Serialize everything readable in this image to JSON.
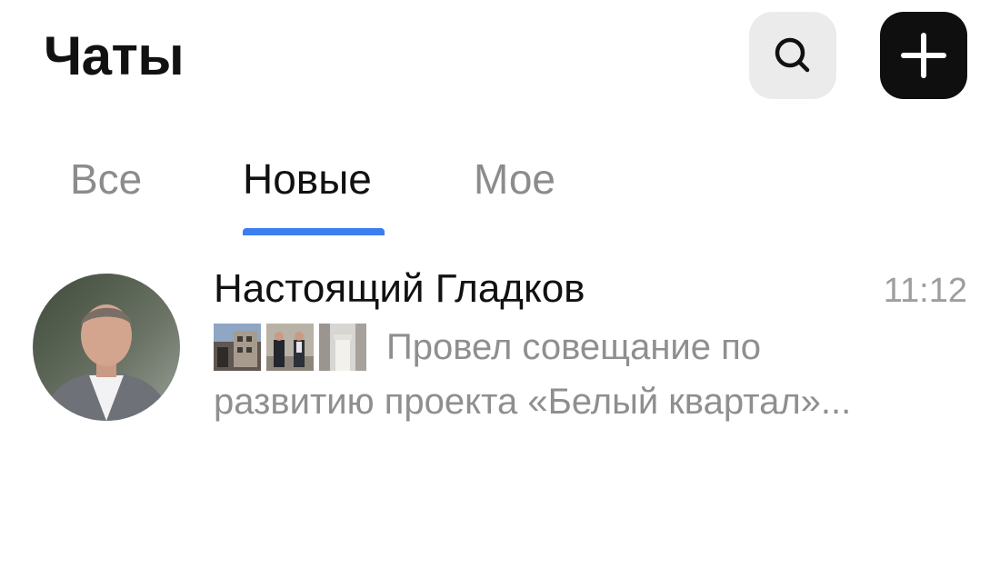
{
  "header": {
    "title": "Чаты",
    "search_icon": "search-icon",
    "add_icon": "plus-icon"
  },
  "tabs": [
    {
      "label": "Все",
      "active": false
    },
    {
      "label": "Новые",
      "active": true
    },
    {
      "label": "Мое",
      "active": false
    }
  ],
  "colors": {
    "accent": "#3a7ef0",
    "title": "#111111",
    "muted": "#8f8f8f",
    "add_button": "#0f0f0f",
    "search_button": "#ebebeb"
  },
  "chats": [
    {
      "name": "Настоящий Гладков",
      "time": "11:12",
      "preview_line1": "Провел совещание по",
      "preview_line2": "развитию проекта «Белый квартал»...",
      "attachments": [
        "photo-thumbnail",
        "photo-thumbnail",
        "photo-thumbnail"
      ]
    }
  ]
}
